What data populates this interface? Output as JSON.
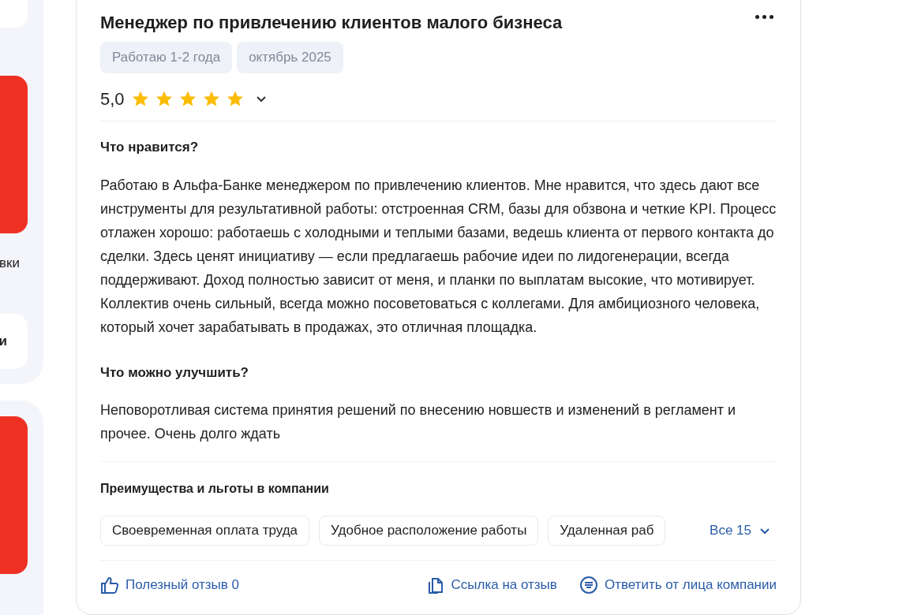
{
  "side_texts": [
    "вки",
    "и"
  ],
  "review": {
    "title": "Менеджер по привлечению клиентов малого бизнеса",
    "tags": [
      "Работаю 1-2 года",
      "октябрь 2025"
    ],
    "rating": "5,0",
    "stars": 5,
    "sections": [
      {
        "heading": "Что нравится?",
        "text": "Работаю в Альфа-Банке менеджером по привлечению клиентов. Мне нравится, что здесь дают все инструменты для результативной работы: отстроенная CRM, базы для обзвона и четкие KPI. Процесс отлажен хорошо: работаешь с холодными и теплыми базами, ведешь клиента от первого контакта до сделки. Здесь ценят инициативу — если предлагаешь рабочие идеи по лидогенерации, всегда поддерживают. Доход полностью зависит от меня, и планки по выплатам высокие, что мотивирует. Коллектив очень сильный, всегда можно посоветоваться с коллегами. Для амбициозного человека, который хочет зарабатывать в продажах, это отличная площадка."
      },
      {
        "heading": "Что можно улучшить?",
        "text": "Неповоротливая система принятия решений по внесению новшеств и изменений в регламент и прочее. Очень долго ждать"
      }
    ],
    "benefits_title": "Преимущества и льготы в компании",
    "benefits": [
      "Своевременная оплата труда",
      "Удобное расположение работы",
      "Удаленная раб"
    ],
    "benefits_more": "Все 15",
    "actions": [
      {
        "kind": "like",
        "label": "Полезный отзыв 0"
      },
      {
        "kind": "link",
        "label": "Ссылка на отзыв"
      },
      {
        "kind": "reply",
        "label": "Ответить от лица компании"
      }
    ]
  }
}
